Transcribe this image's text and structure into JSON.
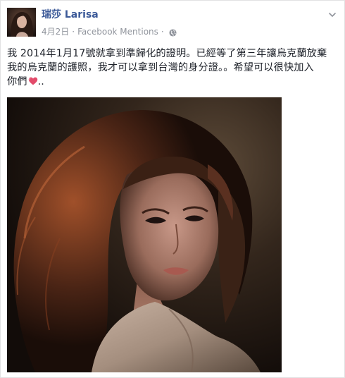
{
  "post": {
    "author_name": "瑞莎 Larisa",
    "date": "4月2日",
    "separator": "·",
    "via": "Facebook Mentions",
    "privacy_icon": "globe-icon",
    "menu_icon": "chevron-down-icon",
    "text_lines": [
      "我 2014年1月17號就拿到準歸化的證明。已經等了第三年讓烏克蘭放棄",
      "我的烏克蘭的護照，我才可以拿到台灣的身分證。。希望可以很快加入",
      "你們"
    ],
    "text_suffix": "..",
    "emoji": "heart-icon",
    "colors": {
      "author_link": "#3b5998",
      "meta_gray": "#90949c",
      "body_text": "#1d2129",
      "heart": "#e34b6b"
    }
  }
}
